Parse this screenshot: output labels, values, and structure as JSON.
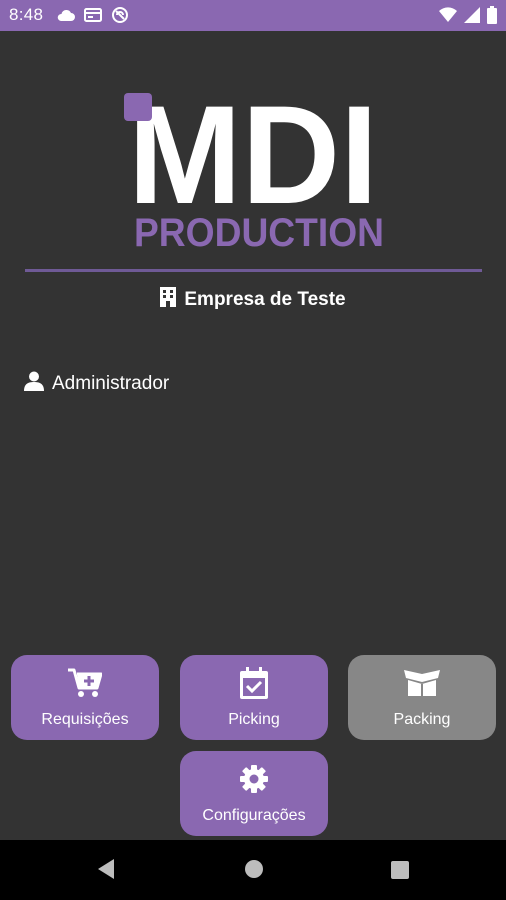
{
  "status_bar": {
    "time": "8:48",
    "left_icons": [
      "cloud-icon",
      "card-icon",
      "sync-icon"
    ],
    "right_icons": [
      "wifi-icon",
      "signal-icon",
      "battery-icon"
    ]
  },
  "logo": {
    "main_text": "MDI",
    "sub_text": "PRODUCTION"
  },
  "company": {
    "icon": "building-icon",
    "name": "Empresa de Teste"
  },
  "user": {
    "icon": "user-icon",
    "name": "Administrador"
  },
  "menu": {
    "requisicoes": {
      "label": "Requisições",
      "icon": "cart-plus-icon",
      "enabled": true
    },
    "picking": {
      "label": "Picking",
      "icon": "calendar-check-icon",
      "enabled": true
    },
    "packing": {
      "label": "Packing",
      "icon": "open-box-icon",
      "enabled": false
    },
    "configuracoes": {
      "label": "Configurações",
      "icon": "gear-icon",
      "enabled": true
    }
  },
  "nav_bar": {
    "buttons": [
      "back-icon",
      "home-icon",
      "recents-icon"
    ]
  },
  "colors": {
    "accent": "#8a68b1",
    "background": "#333333",
    "disabled": "#878787",
    "divider": "#6f5a96",
    "text": "#ffffff"
  }
}
